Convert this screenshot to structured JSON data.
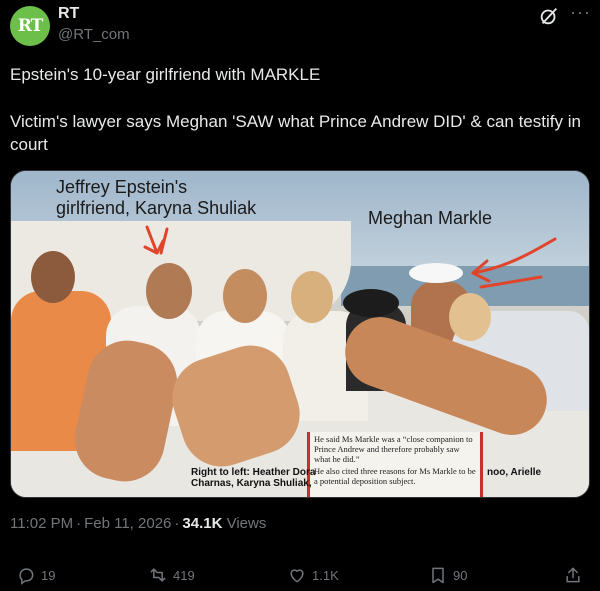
{
  "author": {
    "avatar_text": "RT",
    "display_name": "RT",
    "handle": "@RT_com"
  },
  "tweet": {
    "line1": "Epstein's 10-year girlfriend with MARKLE",
    "line2": "Victim's lawyer says Meghan 'SAW what Prince Andrew DID' & can testify in court"
  },
  "media": {
    "label_left": "Jeffrey Epstein's\ngirlfriend, Karyna Shuliak",
    "label_right": "Meghan Markle",
    "caption_left": "Right to left: Heather Dora\nCharnas, Karyna Shuliak,",
    "caption_right": "noo, Arielle",
    "clipping": {
      "paragraph1": "He said Ms Markle was a “close companion to Prince Andrew and therefore probably saw what he did.”",
      "paragraph2": "He also cited three reasons for Ms Markle to be a potential deposition subject."
    }
  },
  "meta": {
    "time": "11:02 PM",
    "date": "Feb 11, 2026",
    "views_count": "34.1K",
    "views_label": "Views"
  },
  "stats": {
    "replies": "19",
    "reposts": "419",
    "likes": "1.1K",
    "bookmarks": "90"
  },
  "icons": [
    "grok-icon",
    "more-icon",
    "reply-icon",
    "repost-icon",
    "like-icon",
    "bookmark-icon",
    "share-icon"
  ],
  "colors": {
    "background": "#000000",
    "text_primary": "#e7e9ea",
    "text_secondary": "#71767b",
    "avatar": "#6cc04a",
    "arrow": "#e0452b"
  }
}
